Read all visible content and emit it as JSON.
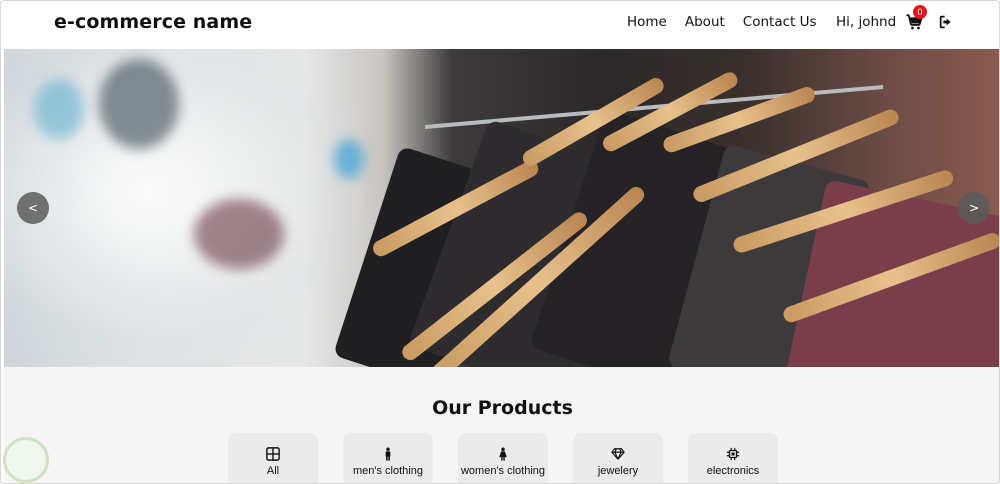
{
  "header": {
    "brand": "e-commerce name",
    "nav": [
      "Home",
      "About",
      "Contact Us"
    ],
    "greeting": "Hi, johnd",
    "cart_count": "0"
  },
  "carousel": {
    "prev_label": "<",
    "next_label": ">"
  },
  "products": {
    "title": "Our Products",
    "categories": [
      {
        "label": "All",
        "icon": "grid-icon"
      },
      {
        "label": "men's clothing",
        "icon": "man-icon"
      },
      {
        "label": "women's clothing",
        "icon": "woman-icon"
      },
      {
        "label": "jewelery",
        "icon": "gem-icon"
      },
      {
        "label": "electronics",
        "icon": "chip-icon"
      }
    ]
  },
  "colors": {
    "badge": "#e0141e",
    "section_bg": "#f5f5f5",
    "category_bg": "#ebebeb"
  }
}
